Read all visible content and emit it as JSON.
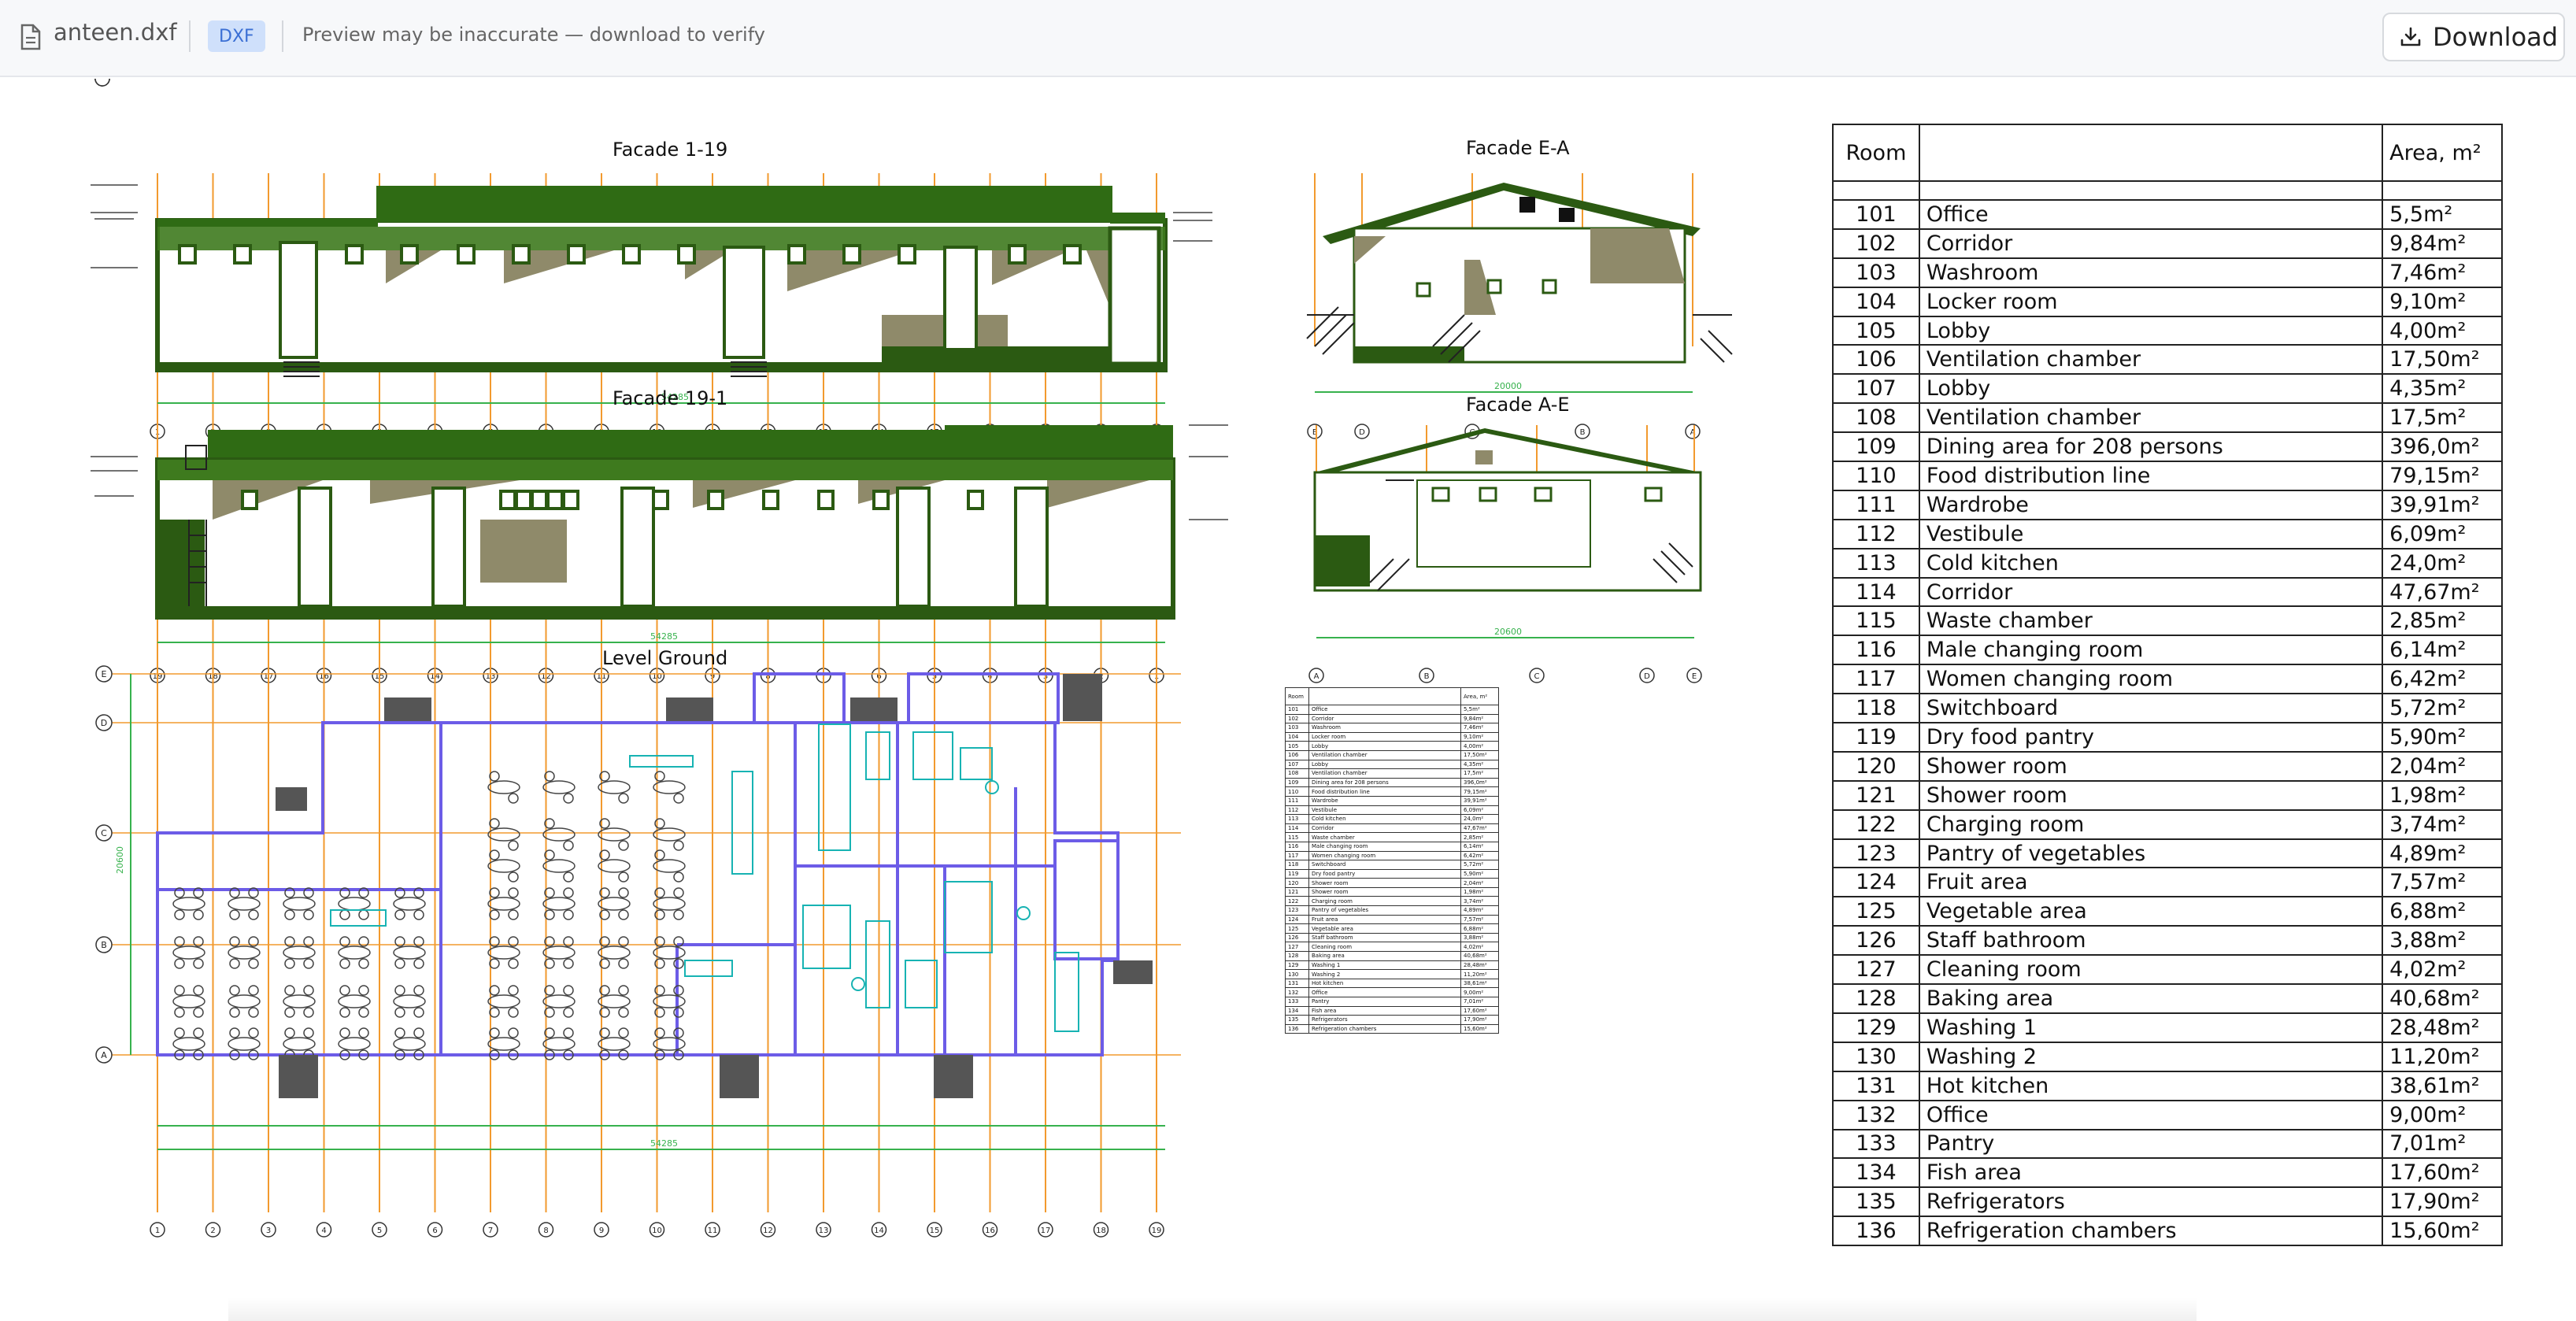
{
  "toolbar": {
    "file_name": "anteen.dxf",
    "format_badge": "DXF",
    "notice": "Preview may be inaccurate — download to verify",
    "download_label": "Download"
  },
  "drawing": {
    "views": {
      "facade_1_19": "Facade 1-19",
      "facade_e_a": "Facade  E-A",
      "facade_19_1": "Facade  19-1",
      "facade_a_e": "Facade  A-E",
      "level_ground": "Level Ground"
    },
    "table": {
      "header_room": "Room",
      "header_name": "",
      "header_area": "Area, m²",
      "rows": [
        {
          "num": "101",
          "name": "Office",
          "area": "5,5m²"
        },
        {
          "num": "102",
          "name": "Corridor",
          "area": "9,84m²"
        },
        {
          "num": "103",
          "name": "Washroom",
          "area": "7,46m²"
        },
        {
          "num": "104",
          "name": "Locker room",
          "area": "9,10m²"
        },
        {
          "num": "105",
          "name": "Lobby",
          "area": "4,00m²"
        },
        {
          "num": "106",
          "name": "Ventilation chamber",
          "area": "17,50m²"
        },
        {
          "num": "107",
          "name": "Lobby",
          "area": "4,35m²"
        },
        {
          "num": "108",
          "name": "Ventilation chamber",
          "area": "17,5m²"
        },
        {
          "num": "109",
          "name": "Dining area for 208 persons",
          "area": "396,0m²"
        },
        {
          "num": "110",
          "name": "Food distribution line",
          "area": "79,15m²"
        },
        {
          "num": "111",
          "name": "Wardrobe",
          "area": "39,91m²"
        },
        {
          "num": "112",
          "name": "Vestibule",
          "area": "6,09m²"
        },
        {
          "num": "113",
          "name": "Cold kitchen",
          "area": "24,0m²"
        },
        {
          "num": "114",
          "name": "Corridor",
          "area": "47,67m²"
        },
        {
          "num": "115",
          "name": "Waste chamber",
          "area": "2,85m²"
        },
        {
          "num": "116",
          "name": "Male changing room",
          "area": "6,14m²"
        },
        {
          "num": "117",
          "name": "Women changing room",
          "area": "6,42m²"
        },
        {
          "num": "118",
          "name": "Switchboard",
          "area": "5,72m²"
        },
        {
          "num": "119",
          "name": "Dry food pantry",
          "area": "5,90m²"
        },
        {
          "num": "120",
          "name": "Shower room",
          "area": "2,04m²"
        },
        {
          "num": "121",
          "name": "Shower room",
          "area": "1,98m²"
        },
        {
          "num": "122",
          "name": "Charging room",
          "area": "3,74m²"
        },
        {
          "num": "123",
          "name": "Pantry of vegetables",
          "area": "4,89m²"
        },
        {
          "num": "124",
          "name": "Fruit area",
          "area": "7,57m²"
        },
        {
          "num": "125",
          "name": "Vegetable area",
          "area": "6,88m²"
        },
        {
          "num": "126",
          "name": "Staff bathroom",
          "area": "3,88m²"
        },
        {
          "num": "127",
          "name": "Cleaning room",
          "area": "4,02m²"
        },
        {
          "num": "128",
          "name": "Baking area",
          "area": "40,68m²"
        },
        {
          "num": "129",
          "name": "Washing 1",
          "area": "28,48m²"
        },
        {
          "num": "130",
          "name": "Washing 2",
          "area": "11,20m²"
        },
        {
          "num": "131",
          "name": "Hot kitchen",
          "area": "38,61m²"
        },
        {
          "num": "132",
          "name": "Office",
          "area": "9,00m²"
        },
        {
          "num": "133",
          "name": "Pantry",
          "area": "7,01m²"
        },
        {
          "num": "134",
          "name": "Fish area",
          "area": "17,60m²"
        },
        {
          "num": "135",
          "name": "Refrigerators",
          "area": "17,90m²"
        },
        {
          "num": "136",
          "name": "Refrigeration chambers",
          "area": "15,60m²"
        }
      ]
    },
    "dimensions": {
      "total_length": "54285",
      "facade_ea_width": "20000",
      "facade_ae_width": "20600",
      "plan_depth": "20600"
    },
    "grid_numbers": [
      "1",
      "2",
      "3",
      "4",
      "5",
      "6",
      "7",
      "8",
      "9",
      "10",
      "11",
      "12",
      "13",
      "14",
      "15",
      "16",
      "17",
      "18",
      "19"
    ],
    "grid_letters": [
      "E",
      "D",
      "C",
      "B",
      "A"
    ]
  },
  "colors": {
    "accent": "#3b6fd4",
    "badge_bg": "#cfe0fb",
    "wall_green": "#2b5a12",
    "roof_green": "#2f6b14",
    "shade_olive": "#8f8a6a",
    "axis_orange": "#f29a2e",
    "plan_purple": "#6c5ce7",
    "plan_cyan": "#17b3b3",
    "dim_green": "#37b24d"
  },
  "icons": {
    "file": "file-icon",
    "download": "download-icon"
  }
}
